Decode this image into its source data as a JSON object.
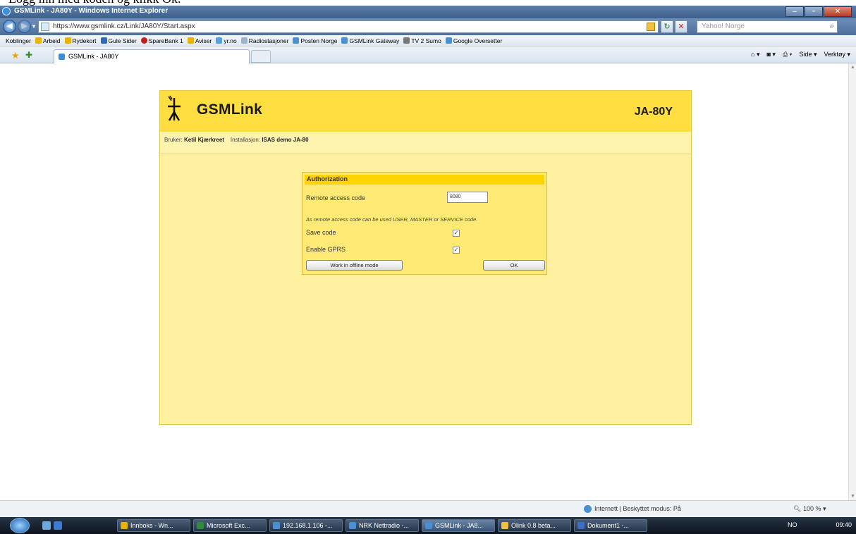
{
  "caption_fragment": "Logg inn med koden og klikk Ok.",
  "window": {
    "title": "GSMLink - JA80Y - Windows Internet Explorer",
    "buttons": [
      "–",
      "▫",
      "✕"
    ]
  },
  "address_bar": {
    "url": "https://www.gsmlink.cz/Link/JA80Y/Start.aspx",
    "search_placeholder": "Yahoo! Norge"
  },
  "links_bar": [
    "Koblinger",
    "Arbeid",
    "Rydekort",
    "Gule Sider",
    "SpareBank 1",
    "Aviser",
    "yr.no",
    "Radiostasjoner",
    "Posten Norge",
    "GSMLink Gateway",
    "TV 2 Sumo",
    "Google Oversetter"
  ],
  "tab": {
    "label": "GSMLink - JA80Y"
  },
  "command_bar": [
    "Side ▾",
    "Verktøy ▾"
  ],
  "gsmlink": {
    "brand": "GSMLink",
    "model": "JA-80Y",
    "user_label": "Bruker:",
    "user_value": "Ketil Kjærkreet",
    "install_label": "Installasjon:",
    "install_value": "ISAS demo JA-80",
    "auth": {
      "title": "Authorization",
      "remote_code_label": "Remote access code",
      "remote_code_value": "8080",
      "note": "As remote access code can be used USER, MASTER or SERVICE code.",
      "save_code_label": "Save code",
      "save_code_checked": "✓",
      "gprs_label": "Enable GPRS",
      "gprs_checked": "✓",
      "offline_button": "Work in offline mode",
      "ok_button": "OK"
    }
  },
  "status_bar": {
    "zone": "Internett | Beskyttet modus: På",
    "zoom": "100 %"
  },
  "taskbar": {
    "buttons": [
      "Innboks - Wn...",
      "Microsoft Exc...",
      "192.168.1.106 -...",
      "NRK Nettradio -...",
      "GSMLink - JA8...",
      "Olink 0.8 beta...",
      "Dokument1 -..."
    ],
    "tray": "NO",
    "clock": "09:40"
  },
  "colors": {
    "page_bg": "#fff1a0",
    "header": "#ffde42",
    "auth_head": "#ffd400"
  }
}
